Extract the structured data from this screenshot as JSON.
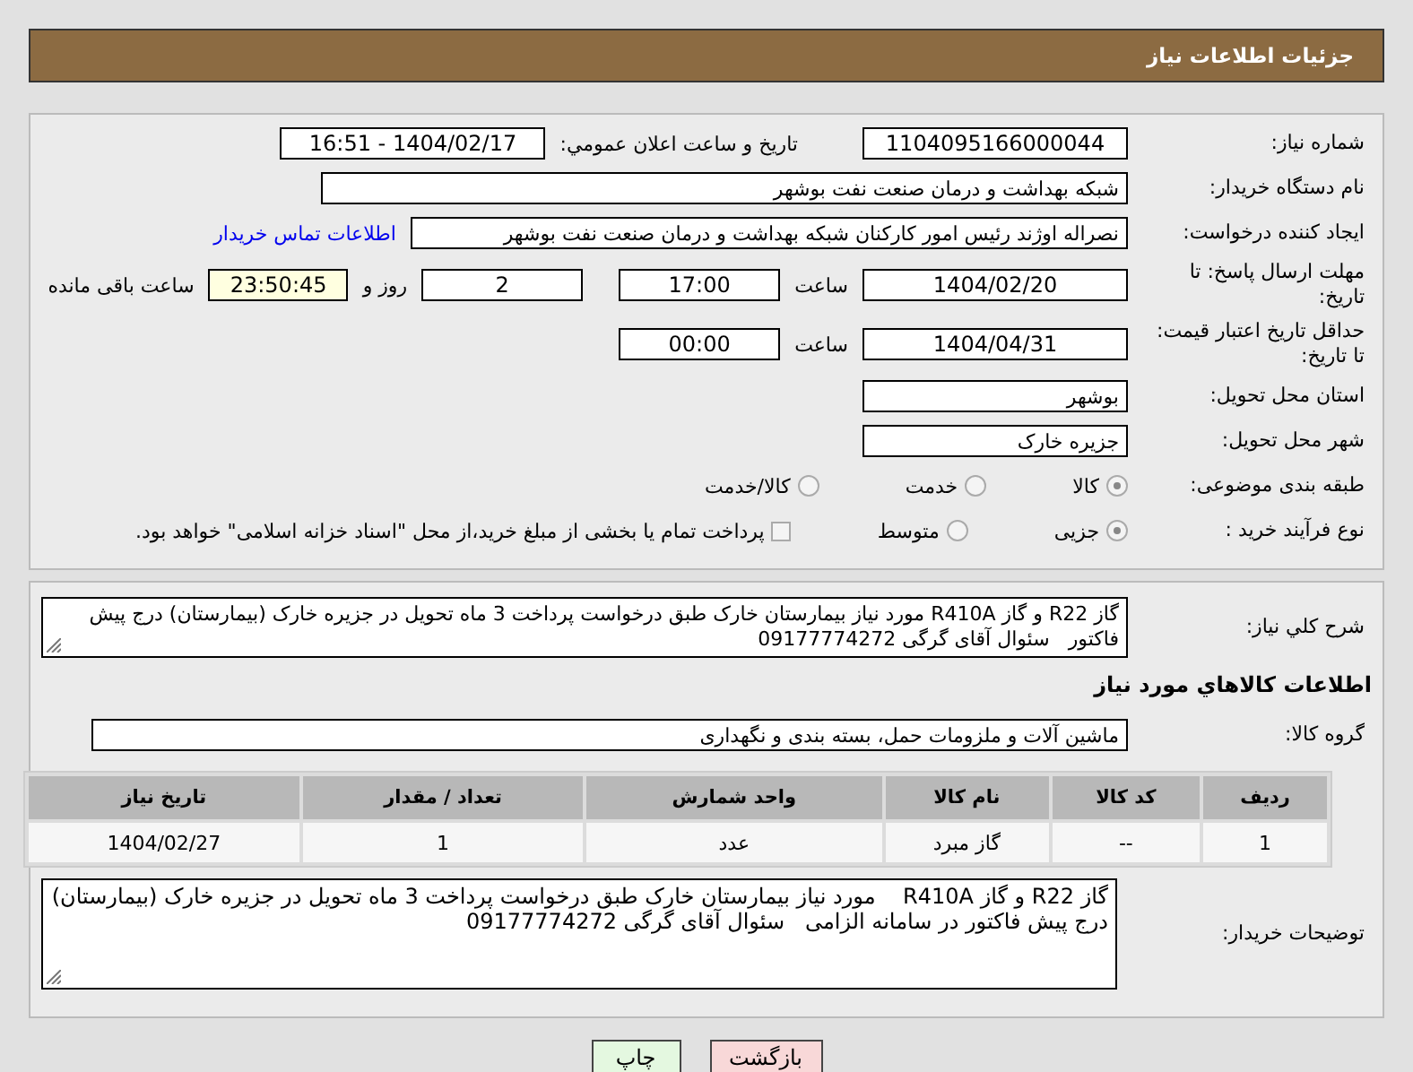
{
  "header": {
    "title": "جزئیات اطلاعات نیاز"
  },
  "need_number": {
    "label": "شماره نیاز:",
    "value": "1104095166000044"
  },
  "announce": {
    "label": "تاریخ و ساعت اعلان عمومي:",
    "value": "1404/02/17 - 16:51"
  },
  "buyer_org": {
    "label": "نام دستگاه خريدار:",
    "value": "شبکه بهداشت و درمان صنعت نفت بوشهر"
  },
  "requester": {
    "label": "ايجاد کننده درخواست:",
    "value": "نصراله اوژند رئیس امور کارکنان شبکه بهداشت و درمان صنعت نفت بوشهر",
    "link": "اطلاعات تماس خريدار"
  },
  "deadline": {
    "label": "مهلت ارسال پاسخ: تا تاریخ:",
    "date": "1404/02/20",
    "time_label": "ساعت",
    "time": "17:00",
    "days": "2",
    "days_label": "روز و",
    "remaining": "23:50:45",
    "remaining_label": "ساعت باقی مانده"
  },
  "validity": {
    "label": "حداقل تاريخ اعتبار قيمت: تا تاريخ:",
    "date": "1404/04/31",
    "time_label": "ساعت",
    "time": "00:00"
  },
  "province": {
    "label": "استان محل تحويل:",
    "value": "بوشهر"
  },
  "city": {
    "label": "شهر محل تحويل:",
    "value": "جزيره خارک"
  },
  "category": {
    "label": "طبقه بندی موضوعی:",
    "options": [
      {
        "label": "کالا",
        "selected": true
      },
      {
        "label": "خدمت",
        "selected": false
      },
      {
        "label": "کالا/خدمت",
        "selected": false
      }
    ]
  },
  "process": {
    "label": "نوع فرآيند خريد :",
    "options": [
      {
        "label": "جزیی",
        "selected": true
      },
      {
        "label": "متوسط",
        "selected": false
      }
    ],
    "payment": {
      "label": "پرداخت تمام يا بخشی از مبلغ خريد،از محل \"اسناد خزانه اسلامی\" خواهد بود.",
      "checked": false
    }
  },
  "description": {
    "label": "شرح کلي نياز:",
    "value": "گاز R22 و گاز R410A مورد نیاز بیمارستان خارک طبق درخواست پرداخت 3 ماه تحویل در جزیره خارک (بیمارستان) درج پیش فاکتور   سئوال آقای گرگی 09177774272"
  },
  "goods_heading": "اطلاعات کالاهاي مورد نياز",
  "group": {
    "label": "گروه کالا:",
    "value": "ماشين آلات و ملزومات حمل، بسته بندی و نگهداری"
  },
  "table": {
    "columns": [
      "رديف",
      "کد کالا",
      "نام کالا",
      "واحد شمارش",
      "تعداد / مقدار",
      "تاريخ نياز"
    ],
    "rows": [
      [
        "1",
        "--",
        "گاز مبرد",
        "عدد",
        "1",
        "1404/02/27"
      ]
    ]
  },
  "buyer_notes": {
    "label": "توضيحات خريدار:",
    "value": "گاز R22 و گاز R410A    مورد نیاز بیمارستان خارک طبق درخواست پرداخت 3 ماه تحویل در جزیره خارک (بیمارستان) درج پیش فاکتور در سامانه الزامی   سئوال آقای گرگی 09177774272"
  },
  "buttons": [
    {
      "label": "بازگشت",
      "kind": "back"
    },
    {
      "label": "چاپ",
      "kind": "print"
    }
  ]
}
